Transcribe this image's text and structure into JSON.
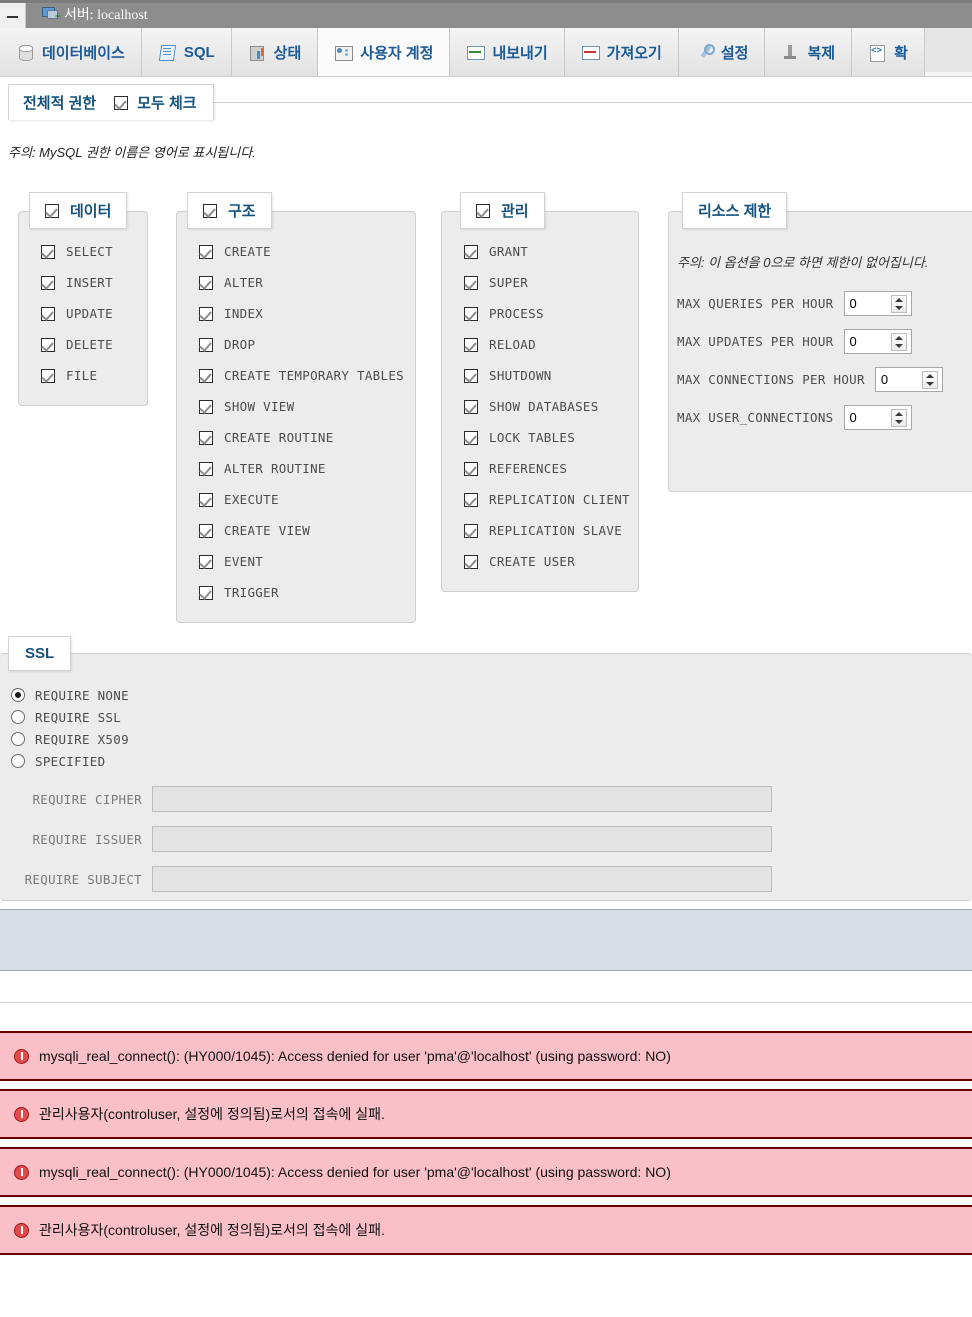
{
  "window": {
    "title": "서버: localhost",
    "title_icon": "server-monitor-icon",
    "minimize_label": "−"
  },
  "tabs": [
    {
      "label": "데이터베이스",
      "icon": "database-icon",
      "active": false
    },
    {
      "label": "SQL",
      "icon": "sql-document-icon",
      "active": false
    },
    {
      "label": "상태",
      "icon": "status-chart-icon",
      "active": false
    },
    {
      "label": "사용자 계정",
      "icon": "user-accounts-icon",
      "active": true
    },
    {
      "label": "내보내기",
      "icon": "export-icon",
      "active": false
    },
    {
      "label": "가져오기",
      "icon": "import-icon",
      "active": false
    },
    {
      "label": "설정",
      "icon": "settings-wrench-icon",
      "active": false
    },
    {
      "label": "복제",
      "icon": "replication-icon",
      "active": false
    },
    {
      "label": "확",
      "icon": "code-file-icon",
      "active": false
    }
  ],
  "global_privileges": {
    "title": "전체적 권한",
    "check_all_label": "모두 체크",
    "check_all_checked": true,
    "note": "주의: MySQL 권한 이름은 영어로 표시됩니다."
  },
  "fieldsets": [
    {
      "legend": "데이터",
      "legend_checked": true,
      "privileges": [
        {
          "label": "SELECT",
          "checked": true
        },
        {
          "label": "INSERT",
          "checked": true
        },
        {
          "label": "UPDATE",
          "checked": true
        },
        {
          "label": "DELETE",
          "checked": true
        },
        {
          "label": "FILE",
          "checked": true
        }
      ]
    },
    {
      "legend": "구조",
      "legend_checked": true,
      "privileges": [
        {
          "label": "CREATE",
          "checked": true
        },
        {
          "label": "ALTER",
          "checked": true
        },
        {
          "label": "INDEX",
          "checked": true
        },
        {
          "label": "DROP",
          "checked": true
        },
        {
          "label": "CREATE TEMPORARY TABLES",
          "checked": true
        },
        {
          "label": "SHOW VIEW",
          "checked": true
        },
        {
          "label": "CREATE ROUTINE",
          "checked": true
        },
        {
          "label": "ALTER ROUTINE",
          "checked": true
        },
        {
          "label": "EXECUTE",
          "checked": true
        },
        {
          "label": "CREATE VIEW",
          "checked": true
        },
        {
          "label": "EVENT",
          "checked": true
        },
        {
          "label": "TRIGGER",
          "checked": true
        }
      ]
    },
    {
      "legend": "관리",
      "legend_checked": true,
      "privileges": [
        {
          "label": "GRANT",
          "checked": true
        },
        {
          "label": "SUPER",
          "checked": true
        },
        {
          "label": "PROCESS",
          "checked": true
        },
        {
          "label": "RELOAD",
          "checked": true
        },
        {
          "label": "SHUTDOWN",
          "checked": true
        },
        {
          "label": "SHOW DATABASES",
          "checked": true
        },
        {
          "label": "LOCK TABLES",
          "checked": true
        },
        {
          "label": "REFERENCES",
          "checked": true
        },
        {
          "label": "REPLICATION CLIENT",
          "checked": true
        },
        {
          "label": "REPLICATION SLAVE",
          "checked": true
        },
        {
          "label": "CREATE USER",
          "checked": true
        }
      ]
    }
  ],
  "resource_limits": {
    "legend": "리소스 제한",
    "note": "주의: 이 옵션을 0으로 하면 제한이 없어집니다.",
    "rows": [
      {
        "label": "MAX QUERIES PER HOUR",
        "value": "0"
      },
      {
        "label": "MAX UPDATES PER HOUR",
        "value": "0"
      },
      {
        "label": "MAX CONNECTIONS PER HOUR",
        "value": "0"
      },
      {
        "label": "MAX USER_CONNECTIONS",
        "value": "0"
      }
    ]
  },
  "ssl": {
    "legend": "SSL",
    "options": [
      {
        "label": "REQUIRE NONE",
        "selected": true
      },
      {
        "label": "REQUIRE SSL",
        "selected": false
      },
      {
        "label": "REQUIRE X509",
        "selected": false
      },
      {
        "label": "SPECIFIED",
        "selected": false
      }
    ],
    "fields": [
      {
        "label": "REQUIRE CIPHER",
        "value": "",
        "placeholder": ""
      },
      {
        "label": "REQUIRE ISSUER",
        "value": "",
        "placeholder": ""
      },
      {
        "label": "REQUIRE SUBJECT",
        "value": "",
        "placeholder": ""
      }
    ]
  },
  "errors": [
    {
      "icon": "error-icon",
      "text": "mysqli_real_connect(): (HY000/1045): Access denied for user 'pma'@'localhost' (using password: NO)"
    },
    {
      "icon": "error-icon",
      "text": "관리사용자(controluser, 설정에 정의됨)로서의 접속에 실패."
    },
    {
      "icon": "error-icon",
      "text": "mysqli_real_connect(): (HY000/1045): Access denied for user 'pma'@'localhost' (using password: NO)"
    },
    {
      "icon": "error-icon",
      "text": "관리사용자(controluser, 설정에 정의됨)로서의 접속에 실패."
    }
  ],
  "colors": {
    "accent": "#15527d",
    "error_bg": "#fbbfc8",
    "error_border": "#6b0000",
    "band": "#d6dde4",
    "fieldset_bg": "#ececec"
  }
}
